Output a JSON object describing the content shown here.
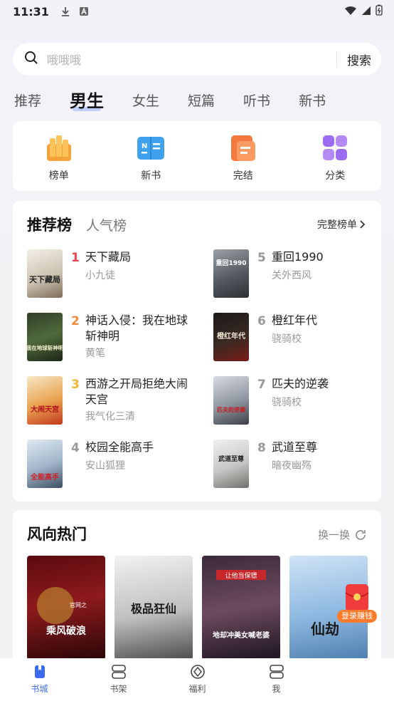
{
  "status": {
    "time": "11:31"
  },
  "search": {
    "placeholder": "哦哦哦",
    "button_label": "搜索"
  },
  "tabs": [
    {
      "label": "推荐"
    },
    {
      "label": "男生",
      "active": true
    },
    {
      "label": "女生"
    },
    {
      "label": "短篇"
    },
    {
      "label": "听书"
    },
    {
      "label": "新书"
    }
  ],
  "categories": [
    {
      "label": "榜单",
      "icon": "ranking-icon"
    },
    {
      "label": "新书",
      "icon": "new-book-icon"
    },
    {
      "label": "完结",
      "icon": "finished-icon"
    },
    {
      "label": "分类",
      "icon": "category-icon"
    }
  ],
  "ranking": {
    "tab_active": "推荐榜",
    "tab_other": "人气榜",
    "more_label": "完整榜单",
    "items": [
      {
        "rank": "1",
        "title": "天下藏局",
        "author": "小九徒",
        "cover_text": "天下藏局"
      },
      {
        "rank": "2",
        "title": "神话入侵：我在地球斩神明",
        "author": "黄笔",
        "cover_text": "我在地球斩神明"
      },
      {
        "rank": "3",
        "title": "西游之开局拒绝大闹天宫",
        "author": "我气化三清",
        "cover_text": "大闹天宫"
      },
      {
        "rank": "4",
        "title": "校园全能高手",
        "author": "安山狐狸",
        "cover_text": "全能高手"
      },
      {
        "rank": "5",
        "title": "重回1990",
        "author": "关外西风",
        "cover_text": "重回1990"
      },
      {
        "rank": "6",
        "title": "橙红年代",
        "author": "骁骑校",
        "cover_text": "橙红年代"
      },
      {
        "rank": "7",
        "title": "匹夫的逆袭",
        "author": "骁骑校",
        "cover_text": "匹夫的逆袭"
      },
      {
        "rank": "8",
        "title": "武道至尊",
        "author": "暗夜幽殇",
        "cover_text": "武道至尊"
      }
    ]
  },
  "hot": {
    "title": "风向热门",
    "refresh_label": "换一换",
    "covers": [
      {
        "text": "乘风破浪",
        "badge": "官网之"
      },
      {
        "text": "极品狂仙",
        "badge": ""
      },
      {
        "text": "地却冲美女喊老婆",
        "badge": "让他当保镖"
      },
      {
        "text": "仙劫",
        "badge": ""
      }
    ],
    "login_bonus": "登录赚钱"
  },
  "bottom_nav": [
    {
      "label": "书城",
      "active": true
    },
    {
      "label": "书架"
    },
    {
      "label": "福利"
    },
    {
      "label": "我"
    }
  ],
  "colors": {
    "accent": "#3c6df0",
    "rank1": "#e8454f",
    "rank2": "#f08a3c",
    "rank3": "#f2b634",
    "rank_other": "#999999"
  }
}
